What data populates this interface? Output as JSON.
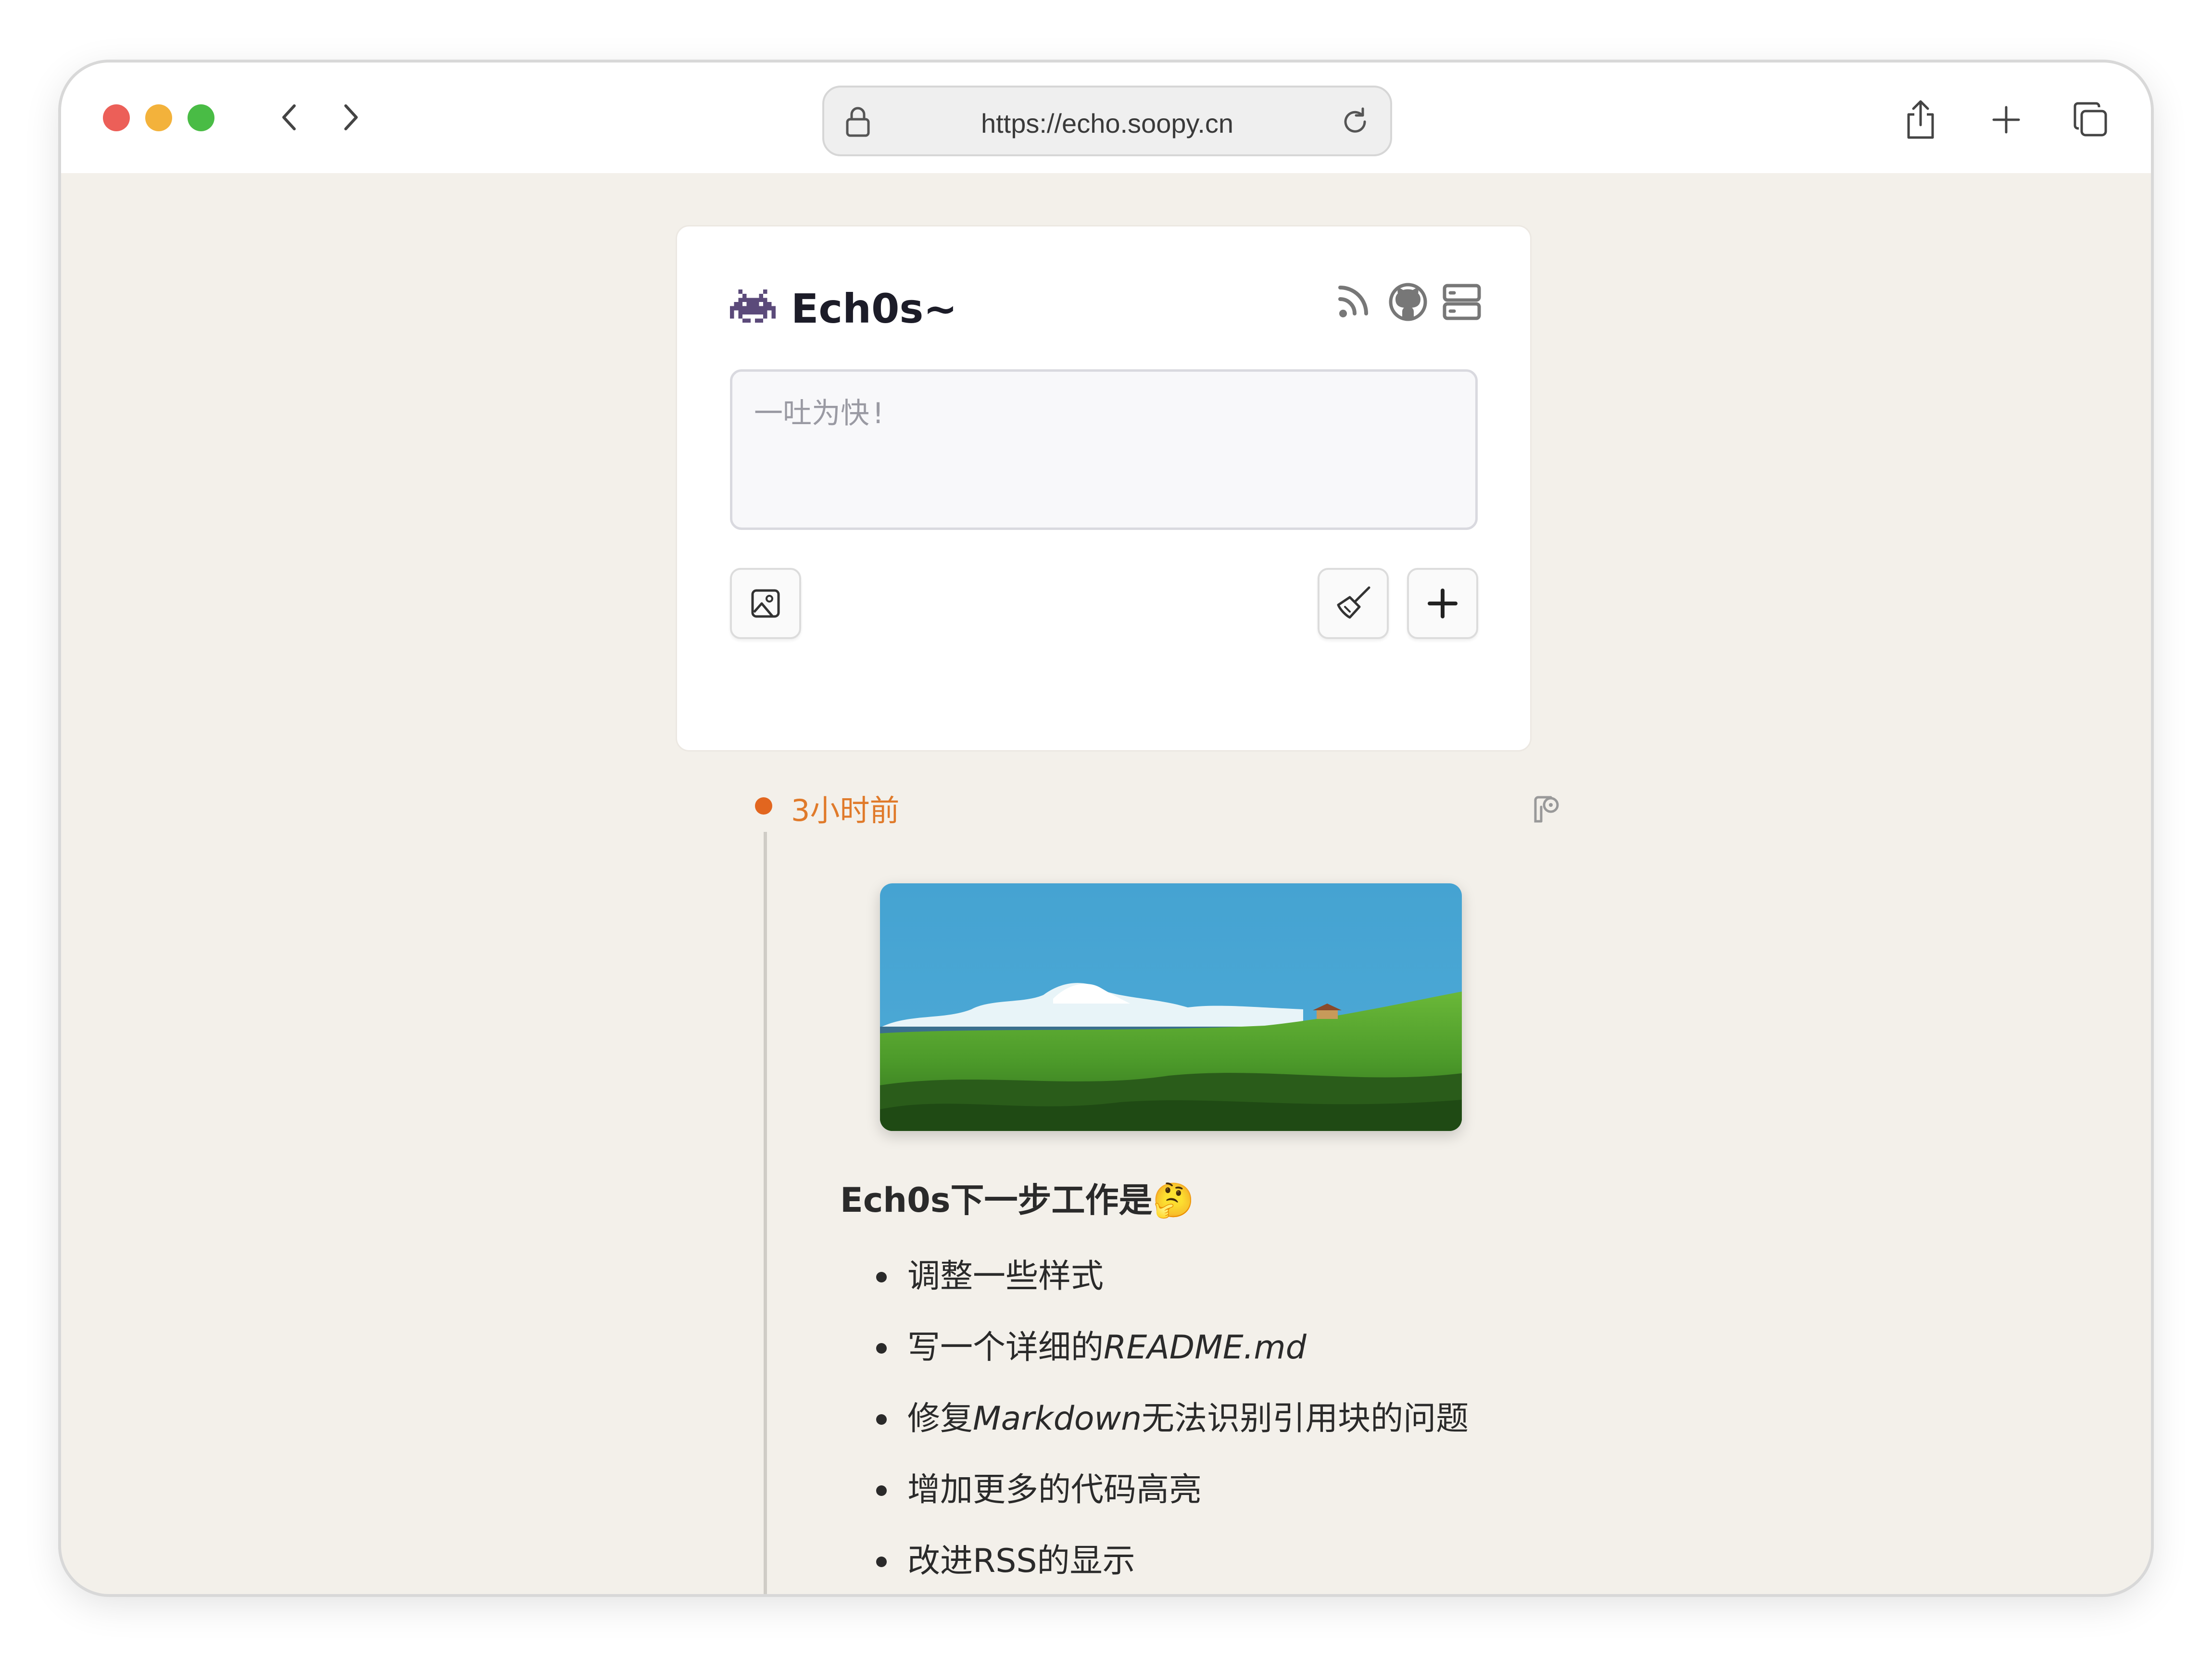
{
  "browser": {
    "url": "https://echo.soopy.cn",
    "back_icon": "chevron-left-icon",
    "forward_icon": "chevron-right-icon",
    "lock_icon": "lock-icon",
    "reload_icon": "reload-icon",
    "share_icon": "share-icon",
    "new_tab_icon": "plus-icon",
    "tabs_icon": "tabs-icon"
  },
  "header": {
    "logo_icon": "space-invader-icon",
    "brand": "Ech0s~",
    "icons": [
      "rss-icon",
      "github-icon",
      "server-icon"
    ]
  },
  "composer": {
    "placeholder": "一吐为快!",
    "image_button_icon": "image-icon",
    "clear_button_icon": "broom-icon",
    "add_button_icon": "plus-icon"
  },
  "timeline": {
    "post": {
      "time": "3小时前",
      "image_alt": "landscape",
      "title": "Ech0s下一步工作是🤔",
      "items": [
        {
          "text": "调整一些样式",
          "em": ""
        },
        {
          "text": "写一个详细的",
          "em": "README.md"
        },
        {
          "text": "修复",
          "em": "Markdown",
          "rest": "无法识别引用块的问题"
        },
        {
          "text": "增加更多的代码高亮",
          "em": ""
        },
        {
          "text": "改进RSS的显示",
          "em": ""
        }
      ]
    }
  },
  "colors": {
    "accent_orange": "#e2661f",
    "page_bg": "#f3f0ea",
    "traffic_red": "#ec5f58",
    "traffic_yellow": "#f3b23b",
    "traffic_green": "#49bc45"
  }
}
